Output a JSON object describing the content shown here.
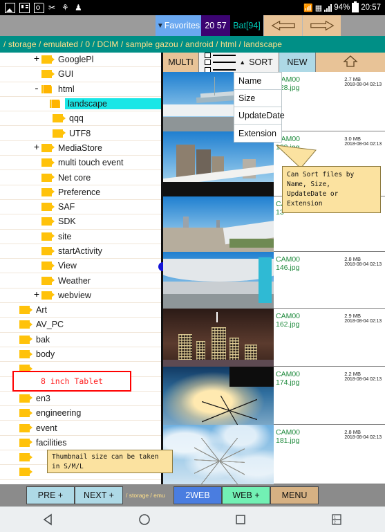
{
  "statusbar": {
    "icons": [
      "photo-icon",
      "sd-card-icon",
      "memory-card-icon",
      "tools-icon",
      "usb-icon",
      "android-icon"
    ],
    "vibrate_icon": "vibrate-icon",
    "network_icon": "network-icon",
    "battery_percent": "94%",
    "time": "20:57"
  },
  "topbar": {
    "favorites_label": "Favorites",
    "favorites_caret": "▼",
    "clock_label": "20 57",
    "battery_label": "Bat[94]",
    "back_arrow": "back-arrow-icon",
    "forward_arrow": "forward-arrow-icon"
  },
  "pathbar": {
    "path": "/ storage / emulated / 0 / DCIM / sample gazou / android / html / landscape"
  },
  "tree": {
    "items": [
      {
        "label": "GooglePl",
        "indent": 2,
        "expander": "+",
        "state": "closed",
        "selected": false
      },
      {
        "label": "GUI",
        "indent": 2,
        "expander": "",
        "state": "closed",
        "selected": false
      },
      {
        "label": "html",
        "indent": 2,
        "expander": "-",
        "state": "open",
        "selected": false
      },
      {
        "label": "landscape",
        "indent": 3,
        "expander": "",
        "state": "open",
        "selected": true
      },
      {
        "label": "qqq",
        "indent": 3,
        "expander": "",
        "state": "closed",
        "selected": false
      },
      {
        "label": "UTF8",
        "indent": 3,
        "expander": "",
        "state": "closed",
        "selected": false
      },
      {
        "label": "MediaStore",
        "indent": 2,
        "expander": "+",
        "state": "closed",
        "selected": false
      },
      {
        "label": "multi touch event",
        "indent": 2,
        "expander": "",
        "state": "closed",
        "selected": false
      },
      {
        "label": "Net core",
        "indent": 2,
        "expander": "",
        "state": "closed",
        "selected": false
      },
      {
        "label": "Preference",
        "indent": 2,
        "expander": "",
        "state": "closed",
        "selected": false
      },
      {
        "label": "SAF",
        "indent": 2,
        "expander": "",
        "state": "closed",
        "selected": false
      },
      {
        "label": "SDK",
        "indent": 2,
        "expander": "",
        "state": "closed",
        "selected": false
      },
      {
        "label": "site",
        "indent": 2,
        "expander": "",
        "state": "closed",
        "selected": false
      },
      {
        "label": "startActivity",
        "indent": 2,
        "expander": "",
        "state": "closed",
        "selected": false
      },
      {
        "label": "View",
        "indent": 2,
        "expander": "",
        "state": "closed",
        "selected": false
      },
      {
        "label": "Weather",
        "indent": 2,
        "expander": "",
        "state": "closed",
        "selected": false
      },
      {
        "label": "webview",
        "indent": 2,
        "expander": "+",
        "state": "closed",
        "selected": false
      },
      {
        "label": "Art",
        "indent": 1,
        "expander": "",
        "state": "closed",
        "selected": false
      },
      {
        "label": "AV_PC",
        "indent": 1,
        "expander": "",
        "state": "closed",
        "selected": false
      },
      {
        "label": "bak",
        "indent": 1,
        "expander": "",
        "state": "closed",
        "selected": false
      },
      {
        "label": "body",
        "indent": 1,
        "expander": "",
        "state": "closed",
        "selected": false
      },
      {
        "label": "",
        "indent": 1,
        "expander": "",
        "state": "closed",
        "selected": false
      },
      {
        "label": "",
        "indent": 1,
        "expander": "",
        "state": "closed",
        "selected": false
      },
      {
        "label": "en3",
        "indent": 1,
        "expander": "",
        "state": "closed",
        "selected": false
      },
      {
        "label": "engineering",
        "indent": 1,
        "expander": "",
        "state": "closed",
        "selected": false
      },
      {
        "label": "event",
        "indent": 1,
        "expander": "",
        "state": "closed",
        "selected": false
      },
      {
        "label": "facilities",
        "indent": 1,
        "expander": "",
        "state": "closed",
        "selected": false
      },
      {
        "label": "",
        "indent": 1,
        "expander": "",
        "state": "closed",
        "selected": false
      },
      {
        "label": "",
        "indent": 1,
        "expander": "",
        "state": "closed",
        "selected": false
      }
    ]
  },
  "filetoolbar": {
    "multi_label": "MULTI",
    "view_icon": "list-view-icon",
    "sort_label": "SORT",
    "sort_caret": "▲",
    "new_label": "NEW",
    "home_icon": "home-up-icon"
  },
  "sortmenu": {
    "items": [
      "Name",
      "Size",
      "UpdateDate",
      "Extension"
    ]
  },
  "files": [
    {
      "name_line1": "CAM00",
      "name_line2": "128.jpg",
      "size": "2.7 MB",
      "date": "2018-08-04 02:13",
      "photo": "bridge"
    },
    {
      "name_line1": "CAM00",
      "name_line2": "129.jpg",
      "size": "3.0 MB",
      "date": "2018-08-04 02:13",
      "photo": "towers"
    },
    {
      "name_line1": "CAM00",
      "name_line2": "13",
      "size": "",
      "date": "",
      "photo": "waterfront"
    },
    {
      "name_line1": "CAM00",
      "name_line2": "146.jpg",
      "size": "2.8 MB",
      "date": "2018-08-04 02:13",
      "photo": "terminal"
    },
    {
      "name_line1": "CAM00",
      "name_line2": "162.jpg",
      "size": "2.9 MB",
      "date": "2018-08-04 02:13",
      "photo": "night"
    },
    {
      "name_line1": "CAM00",
      "name_line2": "174.jpg",
      "size": "2.2 MB",
      "date": "2018-08-04 02:13",
      "photo": "sunset"
    },
    {
      "name_line1": "CAM00",
      "name_line2": "181.jpg",
      "size": "2.8 MB",
      "date": "2018-08-04 02:13",
      "photo": "winter"
    }
  ],
  "callouts": {
    "sort": "Can Sort files by\nName, Size,\nUpdateDate or\nExtension",
    "thumb": "Thumbnail size can be taken\nin S/M/L",
    "tablet": "8 inch Tablet"
  },
  "bottombar": {
    "pre_label": "PRE +",
    "next_label": "NEXT +",
    "path_label": "/ storage / emu",
    "web2_label": "2WEB",
    "web_label": "WEB +",
    "menu_label": "MENU"
  },
  "navbar": {
    "back": "back-triangle-icon",
    "home": "home-circle-icon",
    "recents": "recents-square-icon",
    "split": "split-screen-icon"
  }
}
